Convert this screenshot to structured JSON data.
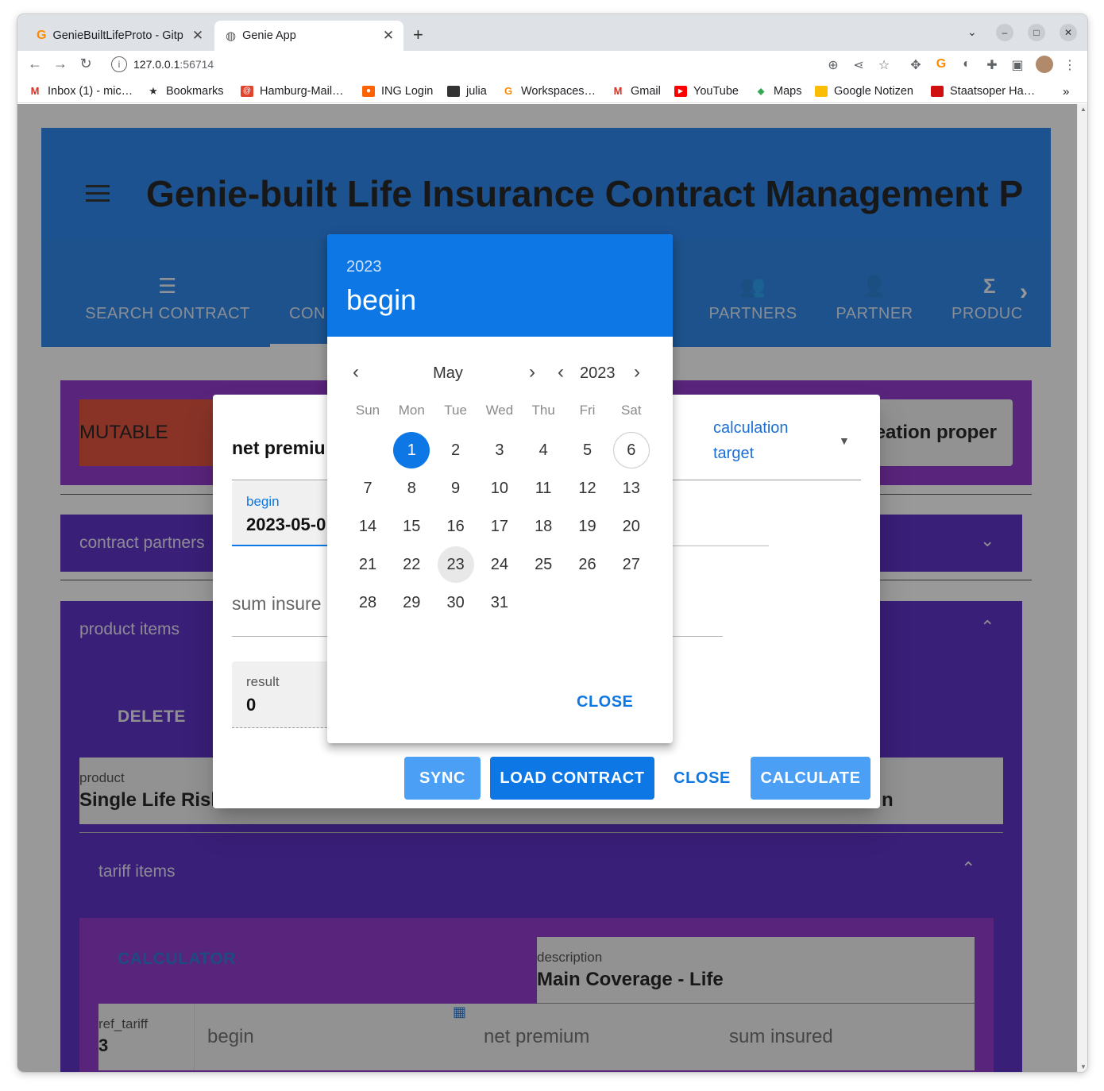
{
  "browser": {
    "tabs": [
      {
        "title": "GenieBuiltLifeProto - Gitp",
        "active": false
      },
      {
        "title": "Genie App",
        "active": true
      }
    ],
    "url_host": "127.0.0.1",
    "url_port": ":56714",
    "bookmarks": [
      {
        "label": "Inbox (1) - mic…",
        "icon": "gmail-icon"
      },
      {
        "label": "Bookmarks",
        "icon": "star-icon"
      },
      {
        "label": "Hamburg-Mail…",
        "icon": "mail-icon"
      },
      {
        "label": "ING Login",
        "icon": "ing-icon"
      },
      {
        "label": "julia",
        "icon": "folder-icon"
      },
      {
        "label": "Workspaces…",
        "icon": "gitpod-icon"
      },
      {
        "label": "Gmail",
        "icon": "gmail-icon"
      },
      {
        "label": "YouTube",
        "icon": "youtube-icon"
      },
      {
        "label": "Maps",
        "icon": "maps-icon"
      },
      {
        "label": "Google Notizen",
        "icon": "keep-icon"
      },
      {
        "label": "Staatsoper Ha…",
        "icon": "staatsoper-icon"
      }
    ],
    "bookmarks_more": "»"
  },
  "app": {
    "title": "Genie-built Life Insurance Contract Management P",
    "tabs": [
      {
        "label": "SEARCH CONTRACT",
        "icon": "list-icon"
      },
      {
        "label": "CON",
        "icon": "contract-icon"
      },
      {
        "label": "PARTNERS",
        "icon": "people-icon"
      },
      {
        "label": "PARTNER",
        "icon": "person-icon"
      },
      {
        "label": "PRODUC",
        "icon": "sigma-icon"
      }
    ],
    "mutable_badge": "MUTABLE",
    "creation_property_chip": "reation proper",
    "contract_partners_label": "contract partners",
    "product_items_label": "product items",
    "delete_label": "DELETE",
    "product_field": {
      "label": "product",
      "value": "Single Life Risk"
    },
    "product_field_right_value": "n",
    "tariff_items_label": "tariff items",
    "calculator_label": "CALCULATOR",
    "description_field": {
      "label": "description",
      "value": "Main Coverage - Life"
    },
    "ref_tariff_field": {
      "label": "ref_tariff",
      "value": "3"
    },
    "tariff_columns": [
      "begin",
      "net premium",
      "sum insured"
    ]
  },
  "dialog": {
    "net_premium_label": "net premiu",
    "calc_target_label": "calculation target",
    "begin_field": {
      "label": "begin",
      "value": "2023-05-0"
    },
    "sum_insured_label": "sum insure",
    "result_field": {
      "label": "result",
      "value": "0"
    },
    "buttons": {
      "sync": "SYNC",
      "load_contract": "LOAD CONTRACT",
      "close": "CLOSE",
      "calculate": "CALCULATE"
    }
  },
  "datepicker": {
    "header_year": "2023",
    "header_title": "begin",
    "month": "May",
    "year": "2023",
    "weekdays": [
      "Sun",
      "Mon",
      "Tue",
      "Wed",
      "Thu",
      "Fri",
      "Sat"
    ],
    "days": [
      "1",
      "2",
      "3",
      "4",
      "5",
      "6",
      "7",
      "8",
      "9",
      "10",
      "11",
      "12",
      "13",
      "14",
      "15",
      "16",
      "17",
      "18",
      "19",
      "20",
      "21",
      "22",
      "23",
      "24",
      "25",
      "26",
      "27",
      "28",
      "29",
      "30",
      "31"
    ],
    "selected_day": "1",
    "today_day": "6",
    "hover_day": "23",
    "close_label": "CLOSE"
  },
  "colors": {
    "primary": "#0d77e5",
    "header_blue": "#1b7cf0",
    "secondary_button": "#4b9ff5",
    "purple": "#8a28c8",
    "indigo": "#4f1fc2",
    "mutable_red": "#e2432d"
  }
}
